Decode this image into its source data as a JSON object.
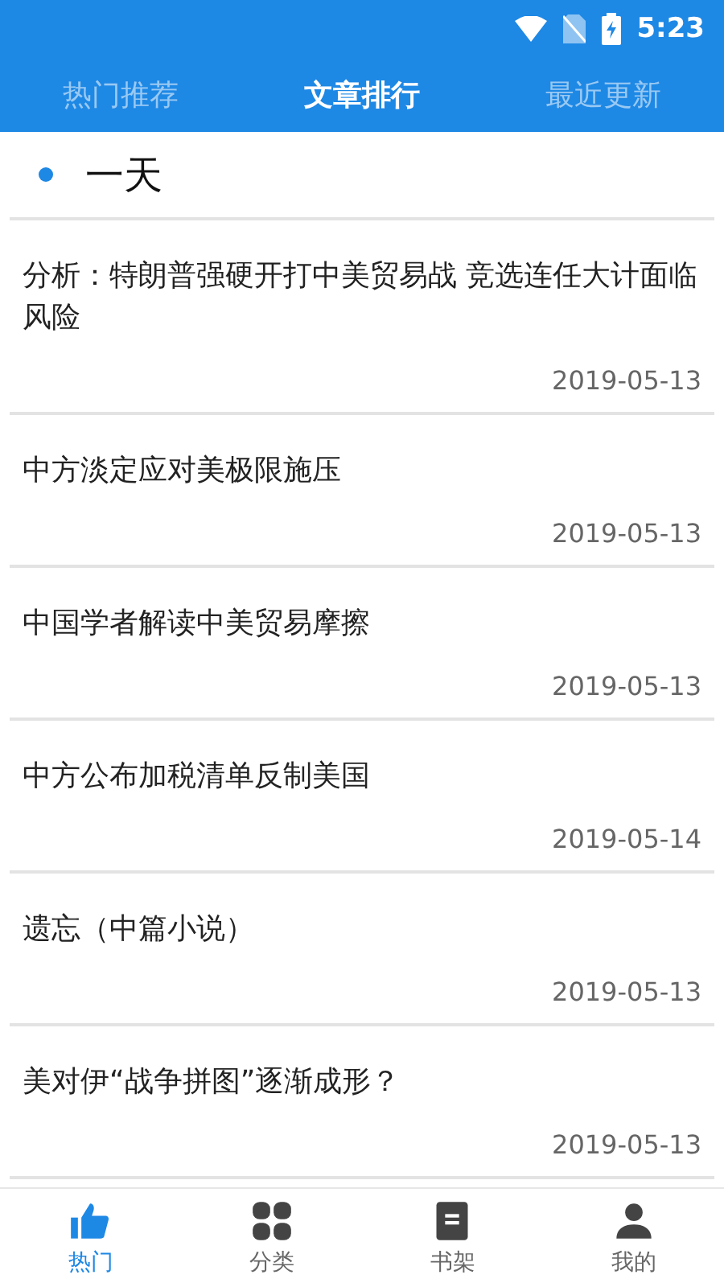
{
  "status_bar": {
    "time": "5:23"
  },
  "tabs": [
    {
      "label": "热门推荐",
      "selected": false
    },
    {
      "label": "文章排行",
      "selected": true
    },
    {
      "label": "最近更新",
      "selected": false
    }
  ],
  "section": {
    "title": "一天"
  },
  "articles": [
    {
      "title": "分析：特朗普强硬开打中美贸易战 竞选连任大计面临风险",
      "date": "2019-05-13"
    },
    {
      "title": "中方淡定应对美极限施压",
      "date": "2019-05-13"
    },
    {
      "title": "中国学者解读中美贸易摩擦",
      "date": "2019-05-13"
    },
    {
      "title": "中方公布加税清单反制美国",
      "date": "2019-05-14"
    },
    {
      "title": "遗忘（中篇小说）",
      "date": "2019-05-13"
    },
    {
      "title": "美对伊“战争拼图”逐渐成形？",
      "date": "2019-05-13"
    }
  ],
  "bottom_nav": [
    {
      "label": "热门",
      "kind": "thumb",
      "selected": true
    },
    {
      "label": "分类",
      "kind": "grid",
      "selected": false
    },
    {
      "label": "书架",
      "kind": "book",
      "selected": false
    },
    {
      "label": "我的",
      "kind": "person",
      "selected": false
    }
  ]
}
